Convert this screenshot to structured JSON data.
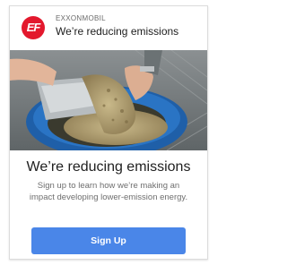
{
  "ad": {
    "advertiser": "EXXONMOBIL",
    "headline": "We’re reducing emissions",
    "logo_text": "EF",
    "hero_alt": "Hands pouring grain from a metal scoop into a blue bucket",
    "title": "We’re reducing emissions",
    "description": "Sign up to learn how we’re making an impact developing lower-emission energy.",
    "cta_label": "Sign Up"
  },
  "colors": {
    "brand": "#e3182d",
    "cta": "#4a86e8"
  }
}
